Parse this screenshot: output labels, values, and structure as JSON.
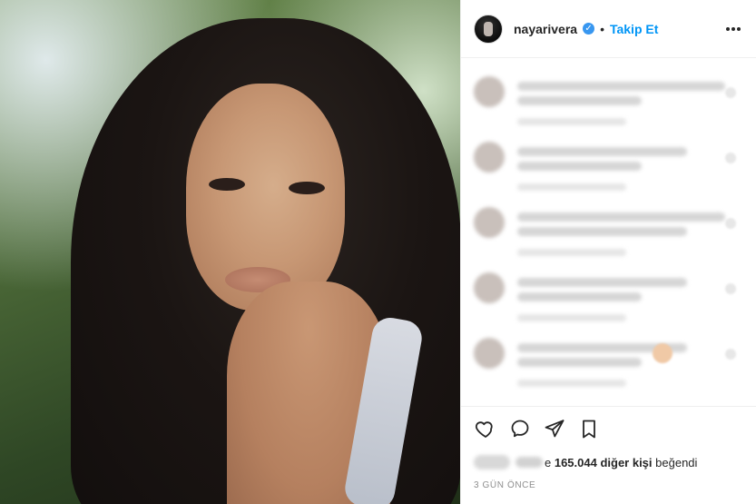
{
  "post": {
    "username": "nayarivera",
    "follow_label": "Takip Et",
    "separator": "•",
    "more_label": "•••"
  },
  "likes": {
    "prefix": "e ",
    "count_and_text": "165.044 diğer kişi",
    "suffix": " beğendi"
  },
  "timestamp": "3 GÜN ÖNCE",
  "icons": {
    "verified": "verified-badge-icon",
    "like": "heart-icon",
    "comment": "comment-icon",
    "share": "send-icon",
    "save": "bookmark-icon",
    "more": "more-icon"
  },
  "colors": {
    "follow_blue": "#0095f6",
    "verified_blue": "#3897f0",
    "text": "#262626",
    "muted": "#8e8e8e",
    "border": "#efefef"
  }
}
